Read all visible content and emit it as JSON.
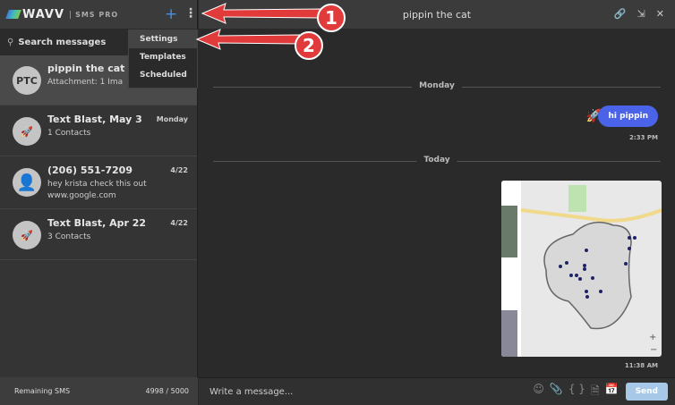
{
  "sidebar": {
    "logo": "WAVV",
    "product": "SMS PRO",
    "search_placeholder": "Search messages",
    "conversations": [
      {
        "avatar": "PTC",
        "name": "pippin the cat",
        "preview": "Attachment: 1 Ima",
        "date": "",
        "icon": "initials"
      },
      {
        "avatar": "",
        "name": "Text Blast, May 3",
        "preview": "1 Contacts",
        "date": "Monday",
        "icon": "rocket-icon"
      },
      {
        "avatar": "",
        "name": "(206) 551-7209",
        "preview": "hey krista check this out www.google.com",
        "date": "4/22",
        "icon": "person-icon"
      },
      {
        "avatar": "",
        "name": "Text Blast, Apr 22",
        "preview": "3 Contacts",
        "date": "4/22",
        "icon": "rocket-icon"
      }
    ],
    "footer": {
      "label": "Remaining SMS",
      "value": "4998 / 5000"
    }
  },
  "menu": {
    "items": [
      "Settings",
      "Templates",
      "Scheduled"
    ]
  },
  "main": {
    "title": "pippin the cat",
    "dividers": [
      "Monday",
      "Today"
    ],
    "messages": [
      {
        "text": "hi pippin",
        "time": "2:33 PM"
      },
      {
        "text": "",
        "time": "11:38 AM",
        "attachment": "map image"
      }
    ],
    "composer_placeholder": "Write a message...",
    "send": "Send"
  },
  "annotations": {
    "one": "1",
    "two": "2",
    "color": "#e03a3a"
  },
  "colors": {
    "accent": "#4b63e8",
    "plus": "#4a90e2"
  }
}
